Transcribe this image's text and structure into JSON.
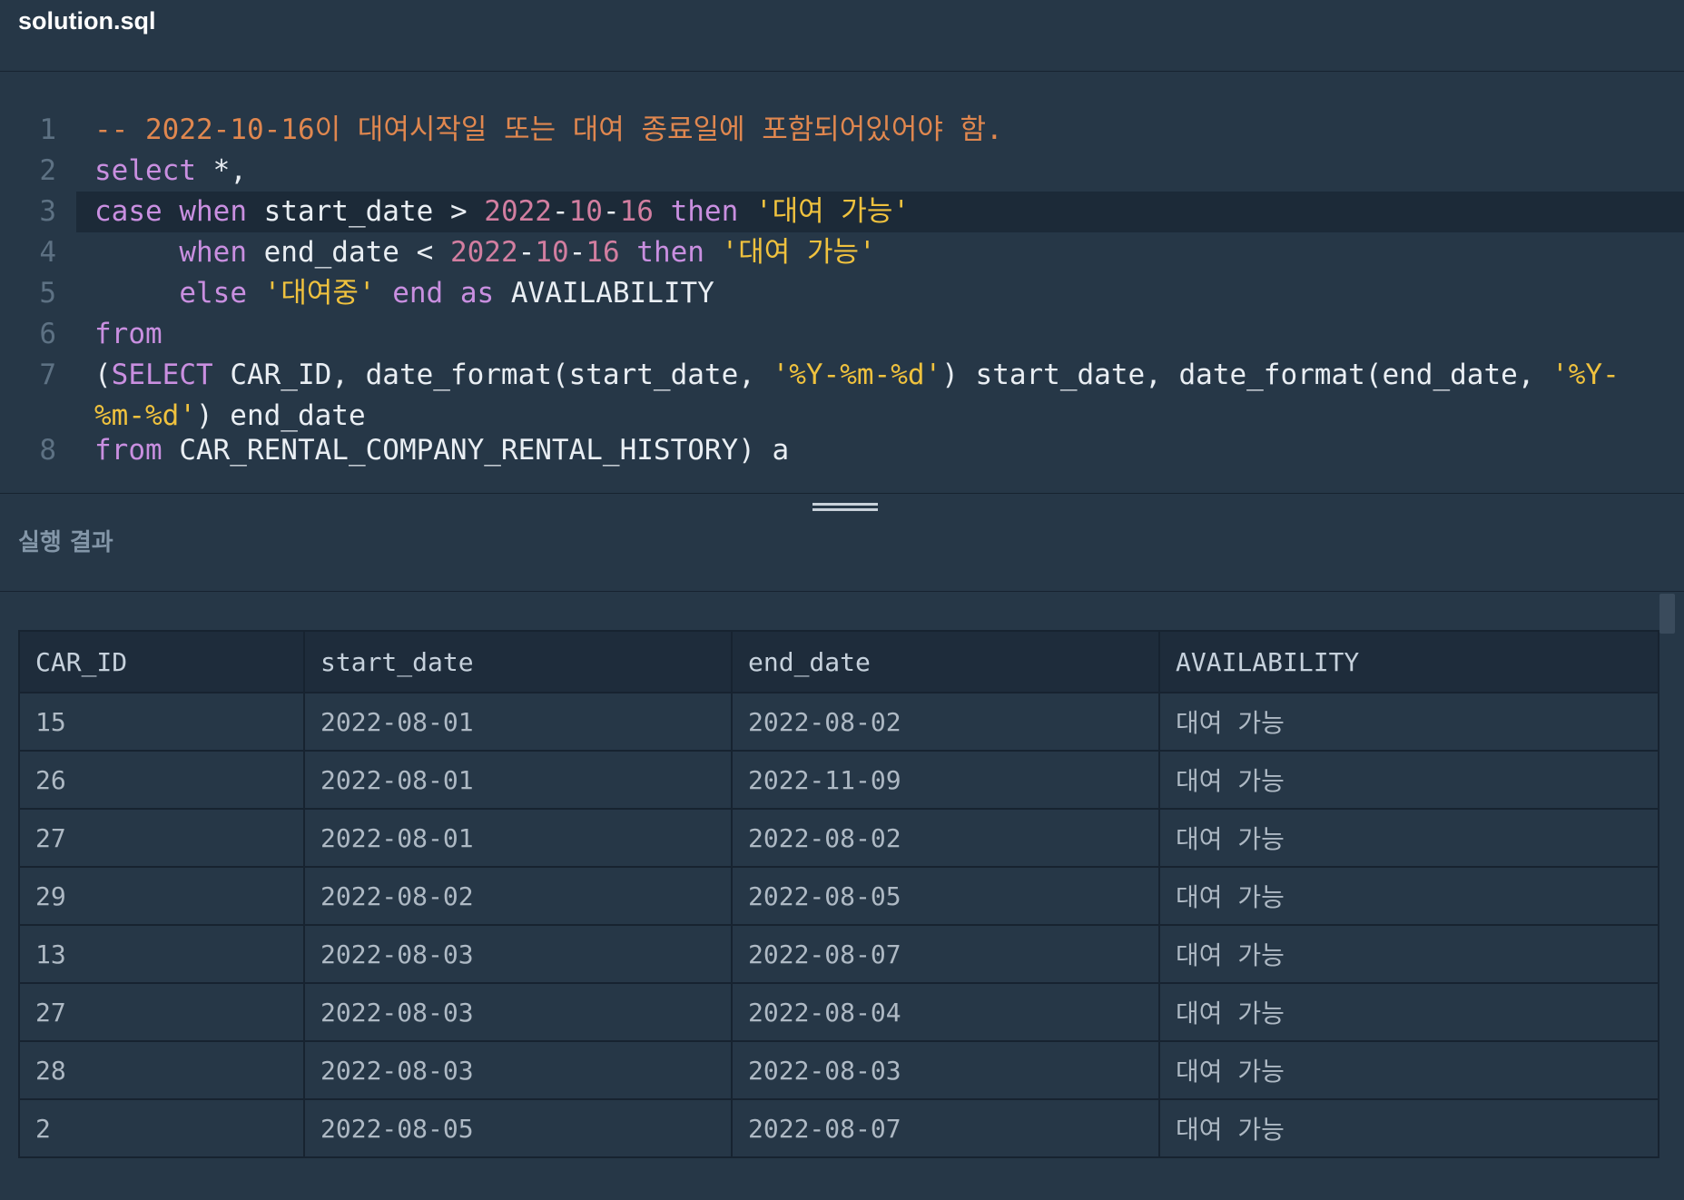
{
  "file": {
    "title": "solution.sql"
  },
  "editor": {
    "lines": [
      {
        "num": "1",
        "tokens": [
          {
            "t": "-- 2022-10-16이 대여시작일 또는 대여 종료일에 포함되어있어야 함.",
            "c": "comment"
          }
        ]
      },
      {
        "num": "2",
        "tokens": [
          {
            "t": "select",
            "c": "kw"
          },
          {
            "t": " *,",
            "c": "plain"
          }
        ]
      },
      {
        "num": "3",
        "tokens": [
          {
            "t": "case",
            "c": "kw"
          },
          {
            "t": " ",
            "c": "plain"
          },
          {
            "t": "when",
            "c": "kw"
          },
          {
            "t": " start_date > ",
            "c": "plain"
          },
          {
            "t": "2022",
            "c": "num"
          },
          {
            "t": "-",
            "c": "plain"
          },
          {
            "t": "10",
            "c": "num"
          },
          {
            "t": "-",
            "c": "plain"
          },
          {
            "t": "16",
            "c": "num"
          },
          {
            "t": " ",
            "c": "plain"
          },
          {
            "t": "then",
            "c": "kw"
          },
          {
            "t": " ",
            "c": "plain"
          },
          {
            "t": "'대여 가능'",
            "c": "str"
          }
        ]
      },
      {
        "num": "4",
        "tokens": [
          {
            "t": "     ",
            "c": "plain"
          },
          {
            "t": "when",
            "c": "kw"
          },
          {
            "t": " end_date < ",
            "c": "plain"
          },
          {
            "t": "2022",
            "c": "num"
          },
          {
            "t": "-",
            "c": "plain"
          },
          {
            "t": "10",
            "c": "num"
          },
          {
            "t": "-",
            "c": "plain"
          },
          {
            "t": "16",
            "c": "num"
          },
          {
            "t": " ",
            "c": "plain"
          },
          {
            "t": "then",
            "c": "kw"
          },
          {
            "t": " ",
            "c": "plain"
          },
          {
            "t": "'대여 가능'",
            "c": "str"
          }
        ]
      },
      {
        "num": "5",
        "tokens": [
          {
            "t": "     ",
            "c": "plain"
          },
          {
            "t": "else",
            "c": "kw"
          },
          {
            "t": " ",
            "c": "plain"
          },
          {
            "t": "'대여중'",
            "c": "str"
          },
          {
            "t": " ",
            "c": "plain"
          },
          {
            "t": "end",
            "c": "kw"
          },
          {
            "t": " ",
            "c": "plain"
          },
          {
            "t": "as",
            "c": "kw"
          },
          {
            "t": " AVAILABILITY",
            "c": "plain"
          }
        ]
      },
      {
        "num": "6",
        "tokens": [
          {
            "t": "from",
            "c": "kw"
          }
        ]
      },
      {
        "num": "7",
        "tokens": [
          {
            "t": "(",
            "c": "plain"
          },
          {
            "t": "SELECT",
            "c": "kw"
          },
          {
            "t": " CAR_ID, date_format(start_date, ",
            "c": "plain"
          },
          {
            "t": "'%Y-%m-%d'",
            "c": "str"
          },
          {
            "t": ") start_date, date_format(end_date, ",
            "c": "plain"
          },
          {
            "t": "'%Y-",
            "c": "str"
          }
        ]
      },
      {
        "num": "",
        "tokens": [
          {
            "t": "%m-%d'",
            "c": "str"
          },
          {
            "t": ") end_date",
            "c": "plain"
          }
        ]
      },
      {
        "num": "8",
        "tokens": [
          {
            "t": "from",
            "c": "kw"
          },
          {
            "t": " CAR_RENTAL_COMPANY_RENTAL_HISTORY) a",
            "c": "plain"
          }
        ]
      }
    ]
  },
  "result": {
    "title": "실행 결과",
    "columns": [
      "CAR_ID",
      "start_date",
      "end_date",
      "AVAILABILITY"
    ],
    "rows": [
      [
        "15",
        "2022-08-01",
        "2022-08-02",
        "대여 가능"
      ],
      [
        "26",
        "2022-08-01",
        "2022-11-09",
        "대여 가능"
      ],
      [
        "27",
        "2022-08-01",
        "2022-08-02",
        "대여 가능"
      ],
      [
        "29",
        "2022-08-02",
        "2022-08-05",
        "대여 가능"
      ],
      [
        "13",
        "2022-08-03",
        "2022-08-07",
        "대여 가능"
      ],
      [
        "27",
        "2022-08-03",
        "2022-08-04",
        "대여 가능"
      ],
      [
        "28",
        "2022-08-03",
        "2022-08-03",
        "대여 가능"
      ],
      [
        "2",
        "2022-08-05",
        "2022-08-07",
        "대여 가능"
      ]
    ]
  }
}
